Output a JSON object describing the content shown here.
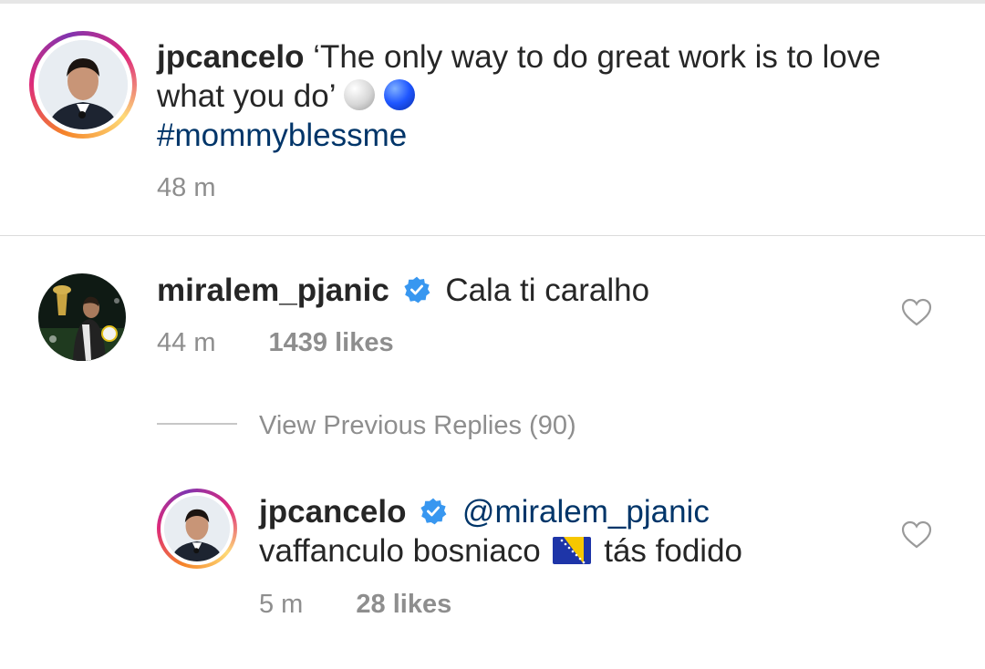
{
  "caption": {
    "username": "jpcancelo",
    "text_line1": "‘The only way to do great work is to love",
    "text_line2": "what you do’",
    "emoji_1": "white-ball-emoji",
    "emoji_2": "blue-ball-emoji",
    "hashtag": "#mommyblessme",
    "time": "48 m"
  },
  "comment": {
    "username": "miralem_pjanic",
    "verified": true,
    "text": "Cala ti caralho",
    "time": "44 m",
    "likes": "1439 likes"
  },
  "replies": {
    "view_previous": "View Previous Replies (90)"
  },
  "reply": {
    "username": "jpcancelo",
    "verified": true,
    "mention": "@miralem_pjanic",
    "text_before_flag": "vaffanculo bosniaco",
    "flag": "bosnia-flag-emoji",
    "text_after_flag": "tás fodido",
    "time": "5 m",
    "likes": "28 likes"
  },
  "colors": {
    "hashtag": "#003569",
    "meta_gray": "#8e8e8e",
    "verified_blue": "#3897f0"
  }
}
